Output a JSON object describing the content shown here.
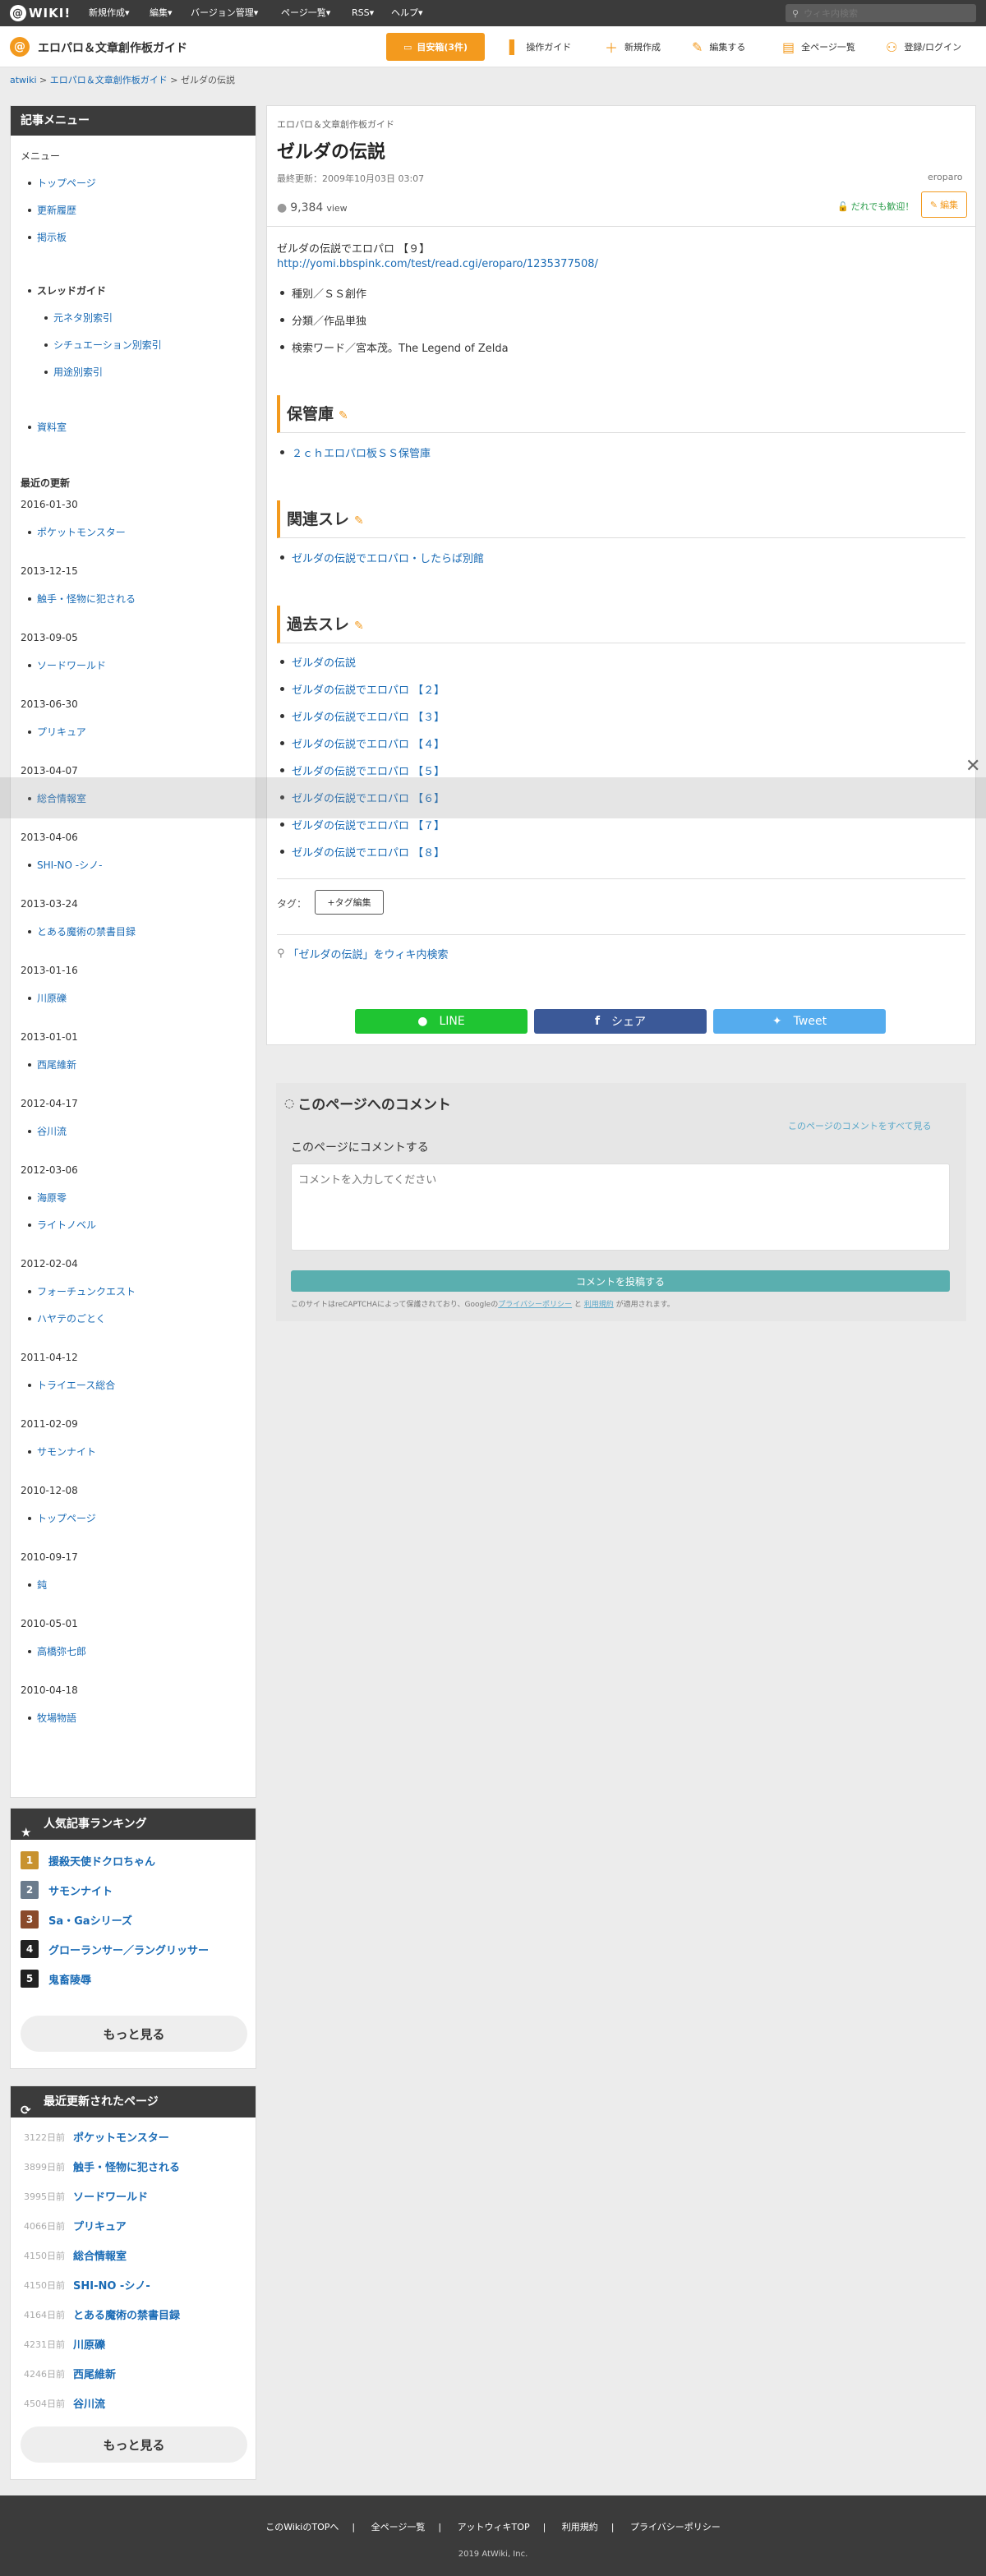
{
  "topbar": {
    "logo_text": "WIKI!",
    "menus": [
      "新規作成▾",
      "編集▾",
      "バージョン管理▾",
      "ページ一覧▾",
      "RSS▾",
      "ヘルプ▾"
    ],
    "search_placeholder": "ウィキ内検索"
  },
  "header": {
    "site_title": "エロパロ＆文章創作板ガイド",
    "bookmark_label": "目安箱(3件)",
    "nav": [
      "操作ガイド",
      "新規作成",
      "編集する",
      "全ページ一覧",
      "登録/ログイン"
    ]
  },
  "breadcrumb": {
    "items": [
      "atwiki",
      "エロパロ＆文章創作板ガイド",
      "ゼルダの伝説"
    ],
    "sep": " > "
  },
  "sidebar": {
    "title": "記事メニュー",
    "menu_label": "メニュー",
    "links": [
      "トップページ",
      "更新履歴",
      "掲示板"
    ],
    "thread_label": "スレッドガイド",
    "thread_links": [
      "元ネタ別索引",
      "シチュエーション別索引",
      "用途別索引"
    ],
    "data_link": "資料室",
    "recent_label": "最近の更新",
    "recent": [
      {
        "date": "2016-01-30",
        "items": [
          "ポケットモンスター"
        ]
      },
      {
        "date": "2013-12-15",
        "items": [
          "触手・怪物に犯される"
        ]
      },
      {
        "date": "2013-09-05",
        "items": [
          "ソードワールド"
        ]
      },
      {
        "date": "2013-06-30",
        "items": [
          "プリキュア"
        ]
      },
      {
        "date": "2013-04-07",
        "items": [
          "総合情報室"
        ]
      },
      {
        "date": "2013-04-06",
        "items": [
          "SHI-NO -シノ-"
        ]
      },
      {
        "date": "2013-03-24",
        "items": [
          "とある魔術の禁書目録"
        ]
      },
      {
        "date": "2013-01-16",
        "items": [
          "川原礫"
        ]
      },
      {
        "date": "2013-01-01",
        "items": [
          "西尾維新"
        ]
      },
      {
        "date": "2012-04-17",
        "items": [
          "谷川流"
        ]
      },
      {
        "date": "2012-03-06",
        "items": [
          "海原零",
          "ライトノベル"
        ]
      },
      {
        "date": "2012-02-04",
        "items": [
          "フォーチュンクエスト",
          "ハヤテのごとく"
        ]
      },
      {
        "date": "2011-04-12",
        "items": [
          "トライエース総合"
        ]
      },
      {
        "date": "2011-02-09",
        "items": [
          "サモンナイト"
        ]
      },
      {
        "date": "2010-12-08",
        "items": [
          "トップページ"
        ]
      },
      {
        "date": "2010-09-17",
        "items": [
          "鈍"
        ]
      },
      {
        "date": "2010-05-01",
        "items": [
          "高橋弥七郎"
        ]
      },
      {
        "date": "2010-04-18",
        "items": [
          "牧場物語"
        ]
      }
    ]
  },
  "article": {
    "site_label": "エロパロ＆文章創作板ガイド",
    "title": "ゼルダの伝説",
    "updated": "最終更新：2009年10月03日 03:07",
    "author": "eroparo",
    "views": "9,384",
    "views_unit": "view",
    "welcome": "だれでも歓迎！",
    "edit": "編集",
    "intro": "ゼルダの伝説でエロパロ 【９】",
    "intro_url": "http://yomi.bbspink.com/test/read.cgi/eroparo/1235377508/",
    "bullets": [
      "種別／ＳＳ創作",
      "分類／作品単独",
      "検索ワード／宮本茂。The Legend of Zelda"
    ],
    "sections": [
      {
        "title": "保管庫",
        "links": [
          "２ｃｈエロパロ板ＳＳ保管庫"
        ]
      },
      {
        "title": "関連スレ",
        "links": [
          "ゼルダの伝説でエロパロ・したらば別館"
        ]
      },
      {
        "title": "過去スレ",
        "links": [
          "ゼルダの伝説",
          "ゼルダの伝説でエロパロ 【２】",
          "ゼルダの伝説でエロパロ 【３】",
          "ゼルダの伝説でエロパロ 【４】",
          "ゼルダの伝説でエロパロ 【５】",
          "ゼルダの伝説でエロパロ 【６】",
          "ゼルダの伝説でエロパロ 【７】",
          "ゼルダの伝説でエロパロ 【８】"
        ]
      }
    ],
    "tag_label": "タグ：",
    "tag_edit": "+タグ編集",
    "wiki_search": "「ゼルダの伝説」をウィキ内検索",
    "share": [
      "LINE",
      "シェア",
      "Tweet"
    ]
  },
  "comments": {
    "title": "このページへのコメント",
    "see_all": "このページのコメントをすべて見る",
    "prompt": "このページにコメントする",
    "placeholder": "コメントを入力してください",
    "submit": "コメントを投稿する",
    "recaptcha": "このサイトはreCAPTCHAによって保護されており、Googleの",
    "privacy": "プライバシーポリシー",
    "and": " と ",
    "terms": "利用規約",
    "applies": " が適用されます。"
  },
  "ranking": {
    "title": "人気記事ランキング",
    "items": [
      {
        "rank": "1",
        "name": "援殺天使ドクロちゃん",
        "color": "#c8922e"
      },
      {
        "rank": "2",
        "name": "サモンナイト",
        "color": "#6b7b8c"
      },
      {
        "rank": "3",
        "name": "Sa・Gaシリーズ",
        "color": "#8a4a2a"
      },
      {
        "rank": "4",
        "name": "グローランサー／ラングリッサー",
        "color": "#222222"
      },
      {
        "rank": "5",
        "name": "鬼畜陵辱",
        "color": "#222222"
      }
    ],
    "more": "もっと見る"
  },
  "recent_pages": {
    "title": "最近更新されたページ",
    "items": [
      {
        "days": "3122日前",
        "name": "ポケットモンスター"
      },
      {
        "days": "3899日前",
        "name": "触手・怪物に犯される"
      },
      {
        "days": "3995日前",
        "name": "ソードワールド"
      },
      {
        "days": "4066日前",
        "name": "プリキュア"
      },
      {
        "days": "4150日前",
        "name": "総合情報室"
      },
      {
        "days": "4150日前",
        "name": "SHI-NO -シノ-"
      },
      {
        "days": "4164日前",
        "name": "とある魔術の禁書目録"
      },
      {
        "days": "4231日前",
        "name": "川原礫"
      },
      {
        "days": "4246日前",
        "name": "西尾維新"
      },
      {
        "days": "4504日前",
        "name": "谷川流"
      }
    ],
    "more": "もっと見る"
  },
  "footer": {
    "links": [
      "このWikiのTOPへ",
      "全ページ一覧",
      "アットウィキTOP",
      "利用規約",
      "プライバシーポリシー"
    ],
    "copyright": "2019 AtWiki, Inc."
  }
}
